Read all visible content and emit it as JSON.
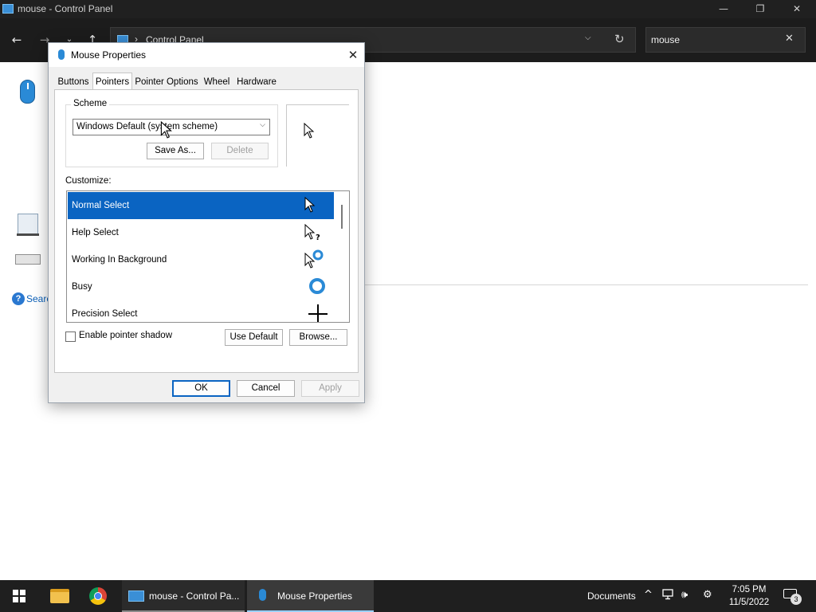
{
  "window": {
    "title": "mouse - Control Panel",
    "controls": {
      "minimize": "—",
      "maximize": "❐",
      "close": "✕"
    }
  },
  "toolbar": {
    "back": "←",
    "forward": "→",
    "recent": "⌄",
    "up": "↑",
    "address_sep": "›",
    "address_crumb": "Control Panel",
    "address_dropdown": "⌵",
    "refresh": "↻",
    "search_value": "mouse",
    "search_clear": "✕"
  },
  "background": {
    "help_icon": "?",
    "help_text": "Searc"
  },
  "dialog": {
    "title": "Mouse Properties",
    "close": "✕",
    "tabs": [
      {
        "label": "Buttons"
      },
      {
        "label": "Pointers",
        "active": true
      },
      {
        "label": "Pointer Options"
      },
      {
        "label": "Wheel"
      },
      {
        "label": "Hardware"
      }
    ],
    "scheme": {
      "legend": "Scheme",
      "selected": "Windows Default (system scheme)",
      "chevron": "⌵",
      "save_as": "Save As...",
      "delete": "Delete"
    },
    "customize_label": "Customize:",
    "cursors": [
      {
        "name": "Normal Select",
        "icon": "arrow-cursor-icon",
        "selected": true
      },
      {
        "name": "Help Select",
        "icon": "help-cursor-icon"
      },
      {
        "name": "Working In Background",
        "icon": "working-cursor-icon"
      },
      {
        "name": "Busy",
        "icon": "busy-cursor-icon"
      },
      {
        "name": "Precision Select",
        "icon": "crosshair-cursor-icon"
      }
    ],
    "enable_shadow_label": "Enable pointer shadow",
    "enable_shadow_checked": false,
    "use_default": "Use Default",
    "browse": "Browse...",
    "ok": "OK",
    "cancel": "Cancel",
    "apply": "Apply"
  },
  "taskbar": {
    "items": [
      {
        "label": "mouse - Control Pa..."
      },
      {
        "label": "Mouse Properties"
      }
    ],
    "documents": "Documents",
    "tray_up": "^",
    "tray_vol": "🕪",
    "tray_gear": "⚙",
    "time": "7:05 PM",
    "date": "11/5/2022",
    "notification_count": "3"
  },
  "colors": {
    "selection": "#0a64c2",
    "accent": "#2a8ad6",
    "taskbar": "#1f1f1f"
  }
}
